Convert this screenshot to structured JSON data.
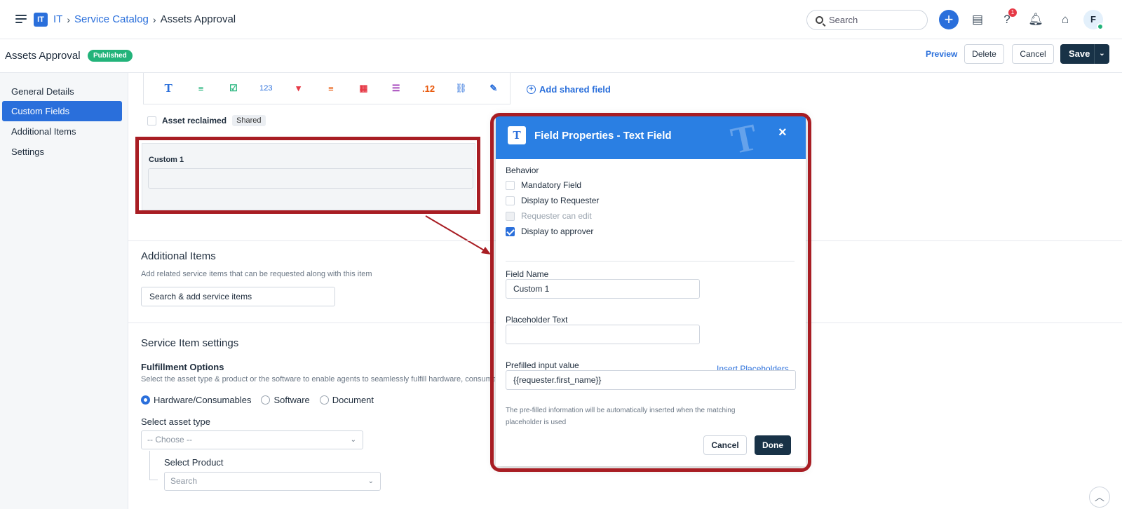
{
  "topbar": {
    "logo": "IT",
    "breadcrumb": [
      "IT",
      "Service Catalog",
      "Assets Approval"
    ],
    "search_placeholder": "Search",
    "notification_count": "1",
    "avatar_initial": "F"
  },
  "header": {
    "title": "Assets Approval",
    "status": "Published",
    "preview": "Preview",
    "delete": "Delete",
    "cancel": "Cancel",
    "save": "Save"
  },
  "sidebar": {
    "items": [
      {
        "label": "General Details"
      },
      {
        "label": "Custom Fields"
      },
      {
        "label": "Additional Items"
      },
      {
        "label": "Settings"
      }
    ]
  },
  "toolbar": {
    "tools": [
      {
        "icon": "text-field-icon",
        "glyph": "T",
        "color": "#2a6fdb"
      },
      {
        "icon": "paragraph-icon",
        "glyph": "≡",
        "color": "#22b37a"
      },
      {
        "icon": "checkbox-icon",
        "glyph": "☑",
        "color": "#22b37a"
      },
      {
        "icon": "number-icon",
        "glyph": "123",
        "color": "#2a6fdb"
      },
      {
        "icon": "dropdown-icon",
        "glyph": "▾",
        "color": "#e63946"
      },
      {
        "icon": "multi-line-icon",
        "glyph": "≡",
        "color": "#e8590c"
      },
      {
        "icon": "date-icon",
        "glyph": "▦",
        "color": "#e63946"
      },
      {
        "icon": "list-icon",
        "glyph": "☰",
        "color": "#9c36b5"
      },
      {
        "icon": "decimal-icon",
        "glyph": ".12",
        "color": "#e8590c"
      },
      {
        "icon": "link-icon",
        "glyph": "🔗",
        "color": "#2a6fdb"
      },
      {
        "icon": "edit-icon",
        "glyph": "✎",
        "color": "#2a6fdb"
      }
    ],
    "add_shared": "Add shared field"
  },
  "fields": {
    "asset_reclaimed": "Asset reclaimed",
    "shared_tag": "Shared",
    "custom_label": "Custom 1"
  },
  "additional_items": {
    "title": "Additional Items",
    "subtitle": "Add related service items that can be requested along with this item",
    "search_placeholder": "Search & add service items"
  },
  "service_settings": {
    "title": "Service Item settings",
    "fulfillment_title": "Fulfillment Options",
    "fulfillment_sub": "Select the asset type & product or the software to enable agents to seamlessly fulfill hardware, consumable",
    "options": [
      "Hardware/Consumables",
      "Software",
      "Document"
    ],
    "selected_option": "Hardware/Consumables",
    "asset_type_label": "Select asset type",
    "asset_type_value": "-- Choose --",
    "product_label": "Select Product",
    "product_value": "Search"
  },
  "modal": {
    "title": "Field Properties - Text Field",
    "behavior_label": "Behavior",
    "checks": [
      {
        "label": "Mandatory Field",
        "checked": false,
        "disabled": false
      },
      {
        "label": "Display to Requester",
        "checked": false,
        "disabled": false
      },
      {
        "label": "Requester can edit",
        "checked": false,
        "disabled": true
      },
      {
        "label": "Display to approver",
        "checked": true,
        "disabled": false
      }
    ],
    "field_name_label": "Field Name",
    "field_name_value": "Custom 1",
    "placeholder_label": "Placeholder Text",
    "placeholder_value": "",
    "prefilled_label": "Prefilled input value",
    "insert_placeholders": "Insert Placeholders",
    "prefilled_value": "{{requester.first_name}}",
    "help": "The pre-filled information will be automatically inserted when the matching placeholder is used",
    "cancel": "Cancel",
    "done": "Done"
  },
  "colors": {
    "accent": "#2a6fdb",
    "modal_header": "#2a7fe3",
    "dark_button": "#183247",
    "published": "#22b37a",
    "highlight_annotation": "#a81d23"
  }
}
